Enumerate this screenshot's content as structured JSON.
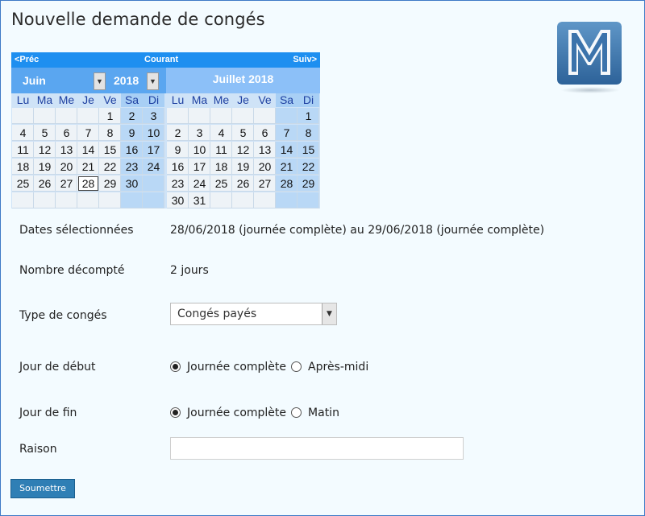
{
  "title": "Nouvelle demande de congés",
  "calendar": {
    "nav": {
      "prev": "<Préc",
      "current": "Courant",
      "next": "Suiv>"
    },
    "month1": {
      "month_select": "Juin",
      "year_select": "2018"
    },
    "month2": {
      "title": "Juillet 2018"
    },
    "weekdays": [
      "Lu",
      "Ma",
      "Me",
      "Je",
      "Ve",
      "Sa",
      "Di"
    ],
    "june_weeks": [
      [
        "",
        "",
        "",
        "",
        "1",
        "2",
        "3"
      ],
      [
        "4",
        "5",
        "6",
        "7",
        "8",
        "9",
        "10"
      ],
      [
        "11",
        "12",
        "13",
        "14",
        "15",
        "16",
        "17"
      ],
      [
        "18",
        "19",
        "20",
        "21",
        "22",
        "23",
        "24"
      ],
      [
        "25",
        "26",
        "27",
        "28",
        "29",
        "30",
        ""
      ],
      [
        "",
        "",
        "",
        "",
        "",
        "",
        ""
      ]
    ],
    "july_weeks": [
      [
        "",
        "",
        "",
        "",
        "",
        "",
        "1"
      ],
      [
        "2",
        "3",
        "4",
        "5",
        "6",
        "7",
        "8"
      ],
      [
        "9",
        "10",
        "11",
        "12",
        "13",
        "14",
        "15"
      ],
      [
        "16",
        "17",
        "18",
        "19",
        "20",
        "21",
        "22"
      ],
      [
        "23",
        "24",
        "25",
        "26",
        "27",
        "28",
        "29"
      ],
      [
        "30",
        "31",
        "",
        "",
        "",
        "",
        ""
      ]
    ],
    "today": "28"
  },
  "form": {
    "dates_label": "Dates sélectionnées",
    "dates_value": "28/06/2018 (journée complète) au 29/06/2018 (journée complète)",
    "count_label": "Nombre décompté",
    "count_value": "2 jours",
    "type_label": "Type de congés",
    "type_value": "Congés payés",
    "start_label": "Jour de début",
    "start_options": [
      "Journée complète",
      "Après-midi"
    ],
    "start_selected": "Journée complète",
    "end_label": "Jour de fin",
    "end_options": [
      "Journée complète",
      "Matin"
    ],
    "end_selected": "Journée complète",
    "reason_label": "Raison",
    "reason_value": "",
    "submit_label": "Soumettre"
  },
  "colors": {
    "nav_bar": "#1e8ff0",
    "month_header": "#5aa6f0",
    "weekend_cell": "#b9d8f6",
    "submit_button": "#2f7fb5",
    "page_border": "#3d79c6"
  },
  "icons": {
    "logo": "m-logo-icon",
    "dropdown": "chevron-down-icon"
  }
}
